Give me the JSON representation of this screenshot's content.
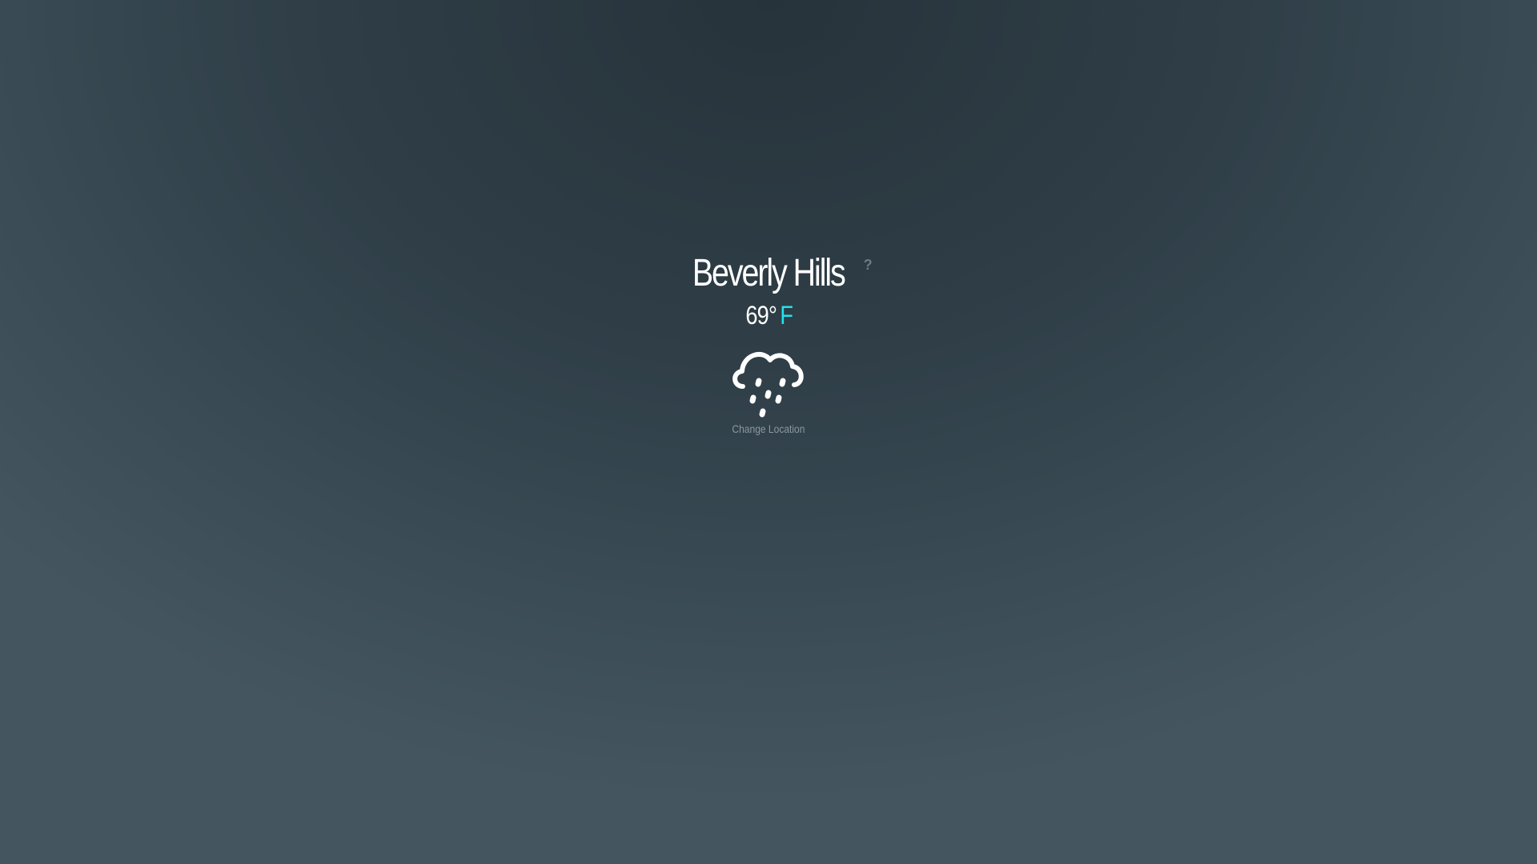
{
  "location": {
    "city": "Beverly Hills",
    "help_label": "?"
  },
  "weather": {
    "temperature": "69°",
    "unit": "F",
    "condition_icon": "rain-cloud-icon"
  },
  "actions": {
    "change_location_label": "Change Location"
  },
  "colors": {
    "accent": "#20e3ef",
    "text": "#ffffff",
    "muted": "#8c979e"
  }
}
